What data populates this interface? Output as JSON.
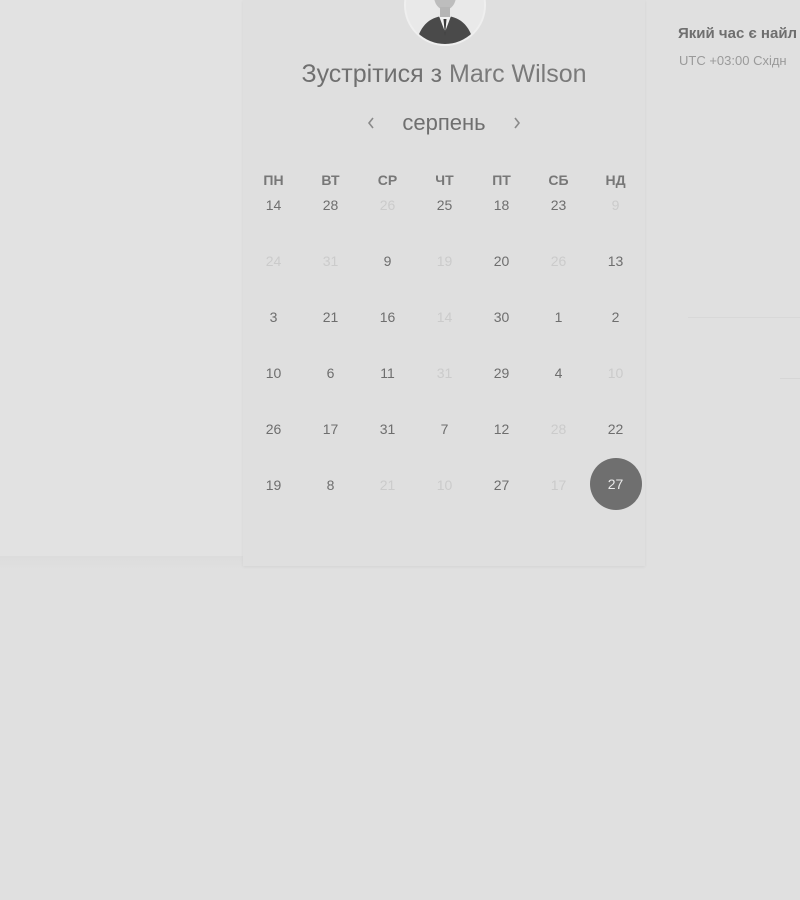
{
  "title": {
    "prefix": "Зустрітися з",
    "name": "Marc Wilson"
  },
  "avatar": {
    "icon": "person-portrait"
  },
  "calendar": {
    "month": "серпень",
    "prev_icon": "chevron-left",
    "next_icon": "chevron-right",
    "weekdays": [
      "ПН",
      "ВТ",
      "СР",
      "ЧТ",
      "ПТ",
      "СБ",
      "НД"
    ],
    "weeks": [
      [
        {
          "d": "14"
        },
        {
          "d": "28"
        },
        {
          "d": "26",
          "muted": true
        },
        {
          "d": "25"
        },
        {
          "d": "18"
        },
        {
          "d": "23"
        },
        {
          "d": "9",
          "muted": true
        }
      ],
      [
        {
          "d": "24",
          "muted": true
        },
        {
          "d": "31",
          "muted": true
        },
        {
          "d": "9"
        },
        {
          "d": "19",
          "muted": true
        },
        {
          "d": "20"
        },
        {
          "d": "26",
          "muted": true
        },
        {
          "d": "13"
        }
      ],
      [
        {
          "d": "3"
        },
        {
          "d": "21"
        },
        {
          "d": "16"
        },
        {
          "d": "14",
          "muted": true
        },
        {
          "d": "30"
        },
        {
          "d": "1"
        },
        {
          "d": "2"
        }
      ],
      [
        {
          "d": "10"
        },
        {
          "d": "6"
        },
        {
          "d": "11"
        },
        {
          "d": "31",
          "muted": true
        },
        {
          "d": "29"
        },
        {
          "d": "4"
        },
        {
          "d": "10",
          "muted": true
        }
      ],
      [
        {
          "d": "26"
        },
        {
          "d": "17"
        },
        {
          "d": "31"
        },
        {
          "d": "7"
        },
        {
          "d": "12"
        },
        {
          "d": "28",
          "muted": true
        },
        {
          "d": "22"
        }
      ],
      [
        {
          "d": "19"
        },
        {
          "d": "8"
        },
        {
          "d": "21",
          "muted": true
        },
        {
          "d": "10",
          "muted": true
        },
        {
          "d": "27"
        },
        {
          "d": "17",
          "muted": true
        },
        {
          "d": "27",
          "selected": true
        }
      ]
    ]
  },
  "time_panel": {
    "question": "Який час є найл",
    "timezone": "UTC +03:00 Східн"
  },
  "colors": {
    "selected_bg": "#6f6f6f",
    "background": "#e0e0e0",
    "muted_text": "#cbcbcb"
  }
}
